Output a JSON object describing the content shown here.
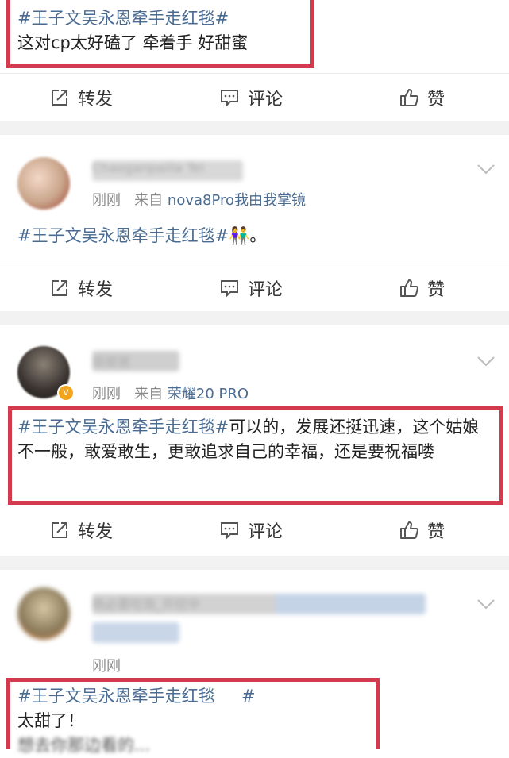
{
  "post1": {
    "hashtag": "#王子文吴永恩牵手走红毯#",
    "text": "这对cp太好磕了 牵着手 好甜蜜"
  },
  "actions": {
    "forward": "转发",
    "comment": "评论",
    "like": "赞"
  },
  "post2": {
    "username": "Chaoganpaiila Tel",
    "time": "刚刚",
    "from_label": "来自",
    "source": "nova8Pro我由我掌镜",
    "hashtag": "#王子文吴永恩牵手走红毯#",
    "emoji": "👫",
    "tail": "。"
  },
  "post3": {
    "username": "叔叔说",
    "time": "刚刚",
    "from_label": "来自",
    "source": "荣耀20 PRO",
    "hashtag": "#王子文吴永恩牵手走红毯#",
    "text": "可以的，发展还挺迅速，这个姑娘不一般，敢爱敢生，更敢追求自己的幸福，还是要祝福喽",
    "badge": "v"
  },
  "post4": {
    "username": "杨必要吃饱_开挖中",
    "time": "刚刚",
    "hashtag": "#王子文吴永恩牵手走红毯",
    "hash_end": "#",
    "text": "太甜了！",
    "partial": "想去你那边看的..."
  },
  "colors": {
    "link": "#4a6b92",
    "highlight_box": "#d43a4e",
    "separator": "#f2f2f2"
  }
}
